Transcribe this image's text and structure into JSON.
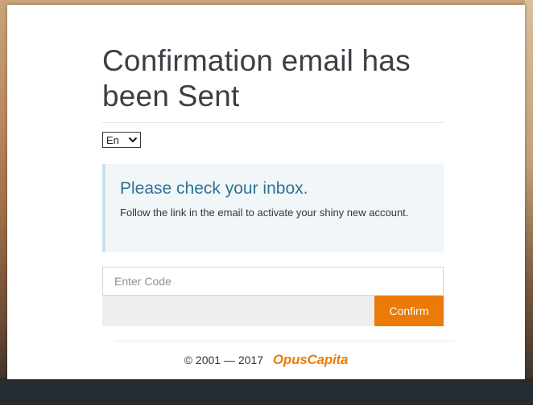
{
  "page": {
    "title": "Confirmation email has been Sent"
  },
  "language": {
    "selected": "En",
    "options": [
      "En"
    ]
  },
  "notice": {
    "heading": "Please check your inbox.",
    "body": "Follow the link in the email to activate your shiny new account."
  },
  "code_input": {
    "value": "",
    "placeholder": "Enter Code"
  },
  "confirm": {
    "label": "Confirm"
  },
  "footer": {
    "copyright": "© 2001 — 2017",
    "brand": "OpusCapita"
  },
  "colors": {
    "accent": "#ec7a08",
    "heading_blue": "#2c7396",
    "notice_bg": "#f1f6f9",
    "notice_border": "#c9e3ec"
  },
  "icons": {
    "language_dropdown": "chevron-down-icon"
  }
}
